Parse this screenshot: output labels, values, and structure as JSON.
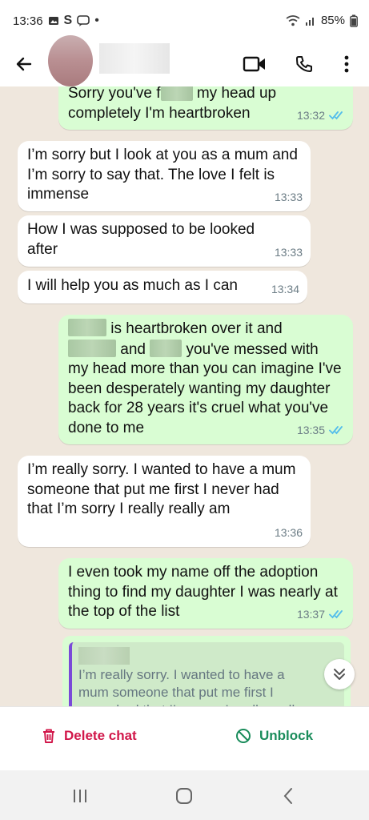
{
  "status": {
    "time": "13:36",
    "battery": "85%"
  },
  "header": {
    "contact_name": "",
    "icons": [
      "back-arrow-icon",
      "video-call-icon",
      "phone-icon",
      "more-vert-icon"
    ]
  },
  "messages": [
    {
      "dir": "out",
      "parts": [
        "Sorry you've f",
        "",
        " my head up completely I'm heartbroken"
      ],
      "time": "13:32"
    },
    {
      "dir": "in",
      "text": "I’m sorry but I look at you as a mum and I’m sorry to say that. The love I felt is immense",
      "time": "13:33"
    },
    {
      "dir": "in",
      "text": "How I was supposed to be looked after",
      "time": "13:33"
    },
    {
      "dir": "in",
      "text": "I will help you as much as I can",
      "time": "13:34"
    },
    {
      "dir": "out",
      "line1": "is heartbroken over it and",
      "line2a": "and",
      "line2b": "you've messed with",
      "rest": "my head more than you can imagine I've been desperately wanting my daughter back for 28 years it's cruel what you've done to me",
      "time": "13:35"
    },
    {
      "dir": "in",
      "text": "I’m really sorry. I wanted to have a mum someone that put me first I never had that I’m sorry I really really am",
      "time": "13:36"
    },
    {
      "dir": "out",
      "text": "I even took my name off the adoption thing to find  my daughter I was nearly at the top of the list",
      "time": "13:37"
    }
  ],
  "reply": {
    "author": "",
    "text": "I’m really sorry. I wanted to have a mum someone that put me first I never had that I’m sorry I really really am"
  },
  "actions": {
    "delete_label": "Delete chat",
    "unblock_label": "Unblock"
  },
  "colors": {
    "delete": "#d1174a",
    "unblock": "#1a8c5b",
    "outgoing_bubble": "#d9fdd3",
    "incoming_bubble": "#ffffff",
    "ticks": "#53bdeb"
  }
}
